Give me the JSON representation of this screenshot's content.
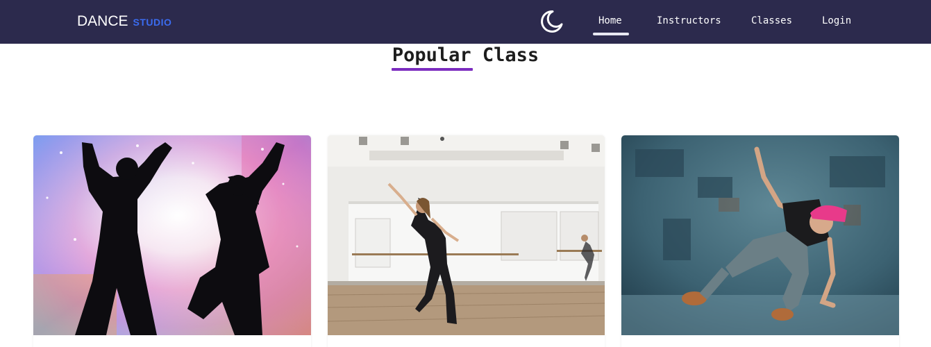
{
  "navbar": {
    "brand_main": "DANCE",
    "brand_sub": "STUDIO",
    "theme_toggle_icon": "moon-icon",
    "links": [
      {
        "label": "Home",
        "active": true
      },
      {
        "label": "Instructors",
        "active": false
      },
      {
        "label": "Classes",
        "active": false
      },
      {
        "label": "Login",
        "active": false
      }
    ]
  },
  "section": {
    "title": "Popular Class"
  },
  "cards": [
    {
      "image": "dancing-silhouettes-image"
    },
    {
      "image": "dance-studio-ballet-image"
    },
    {
      "image": "hip-hop-dancer-image"
    }
  ],
  "colors": {
    "navbar_bg": "#2c2a4d",
    "brand_accent": "#3b6cf0",
    "title_underline": "#7b2cbf"
  }
}
